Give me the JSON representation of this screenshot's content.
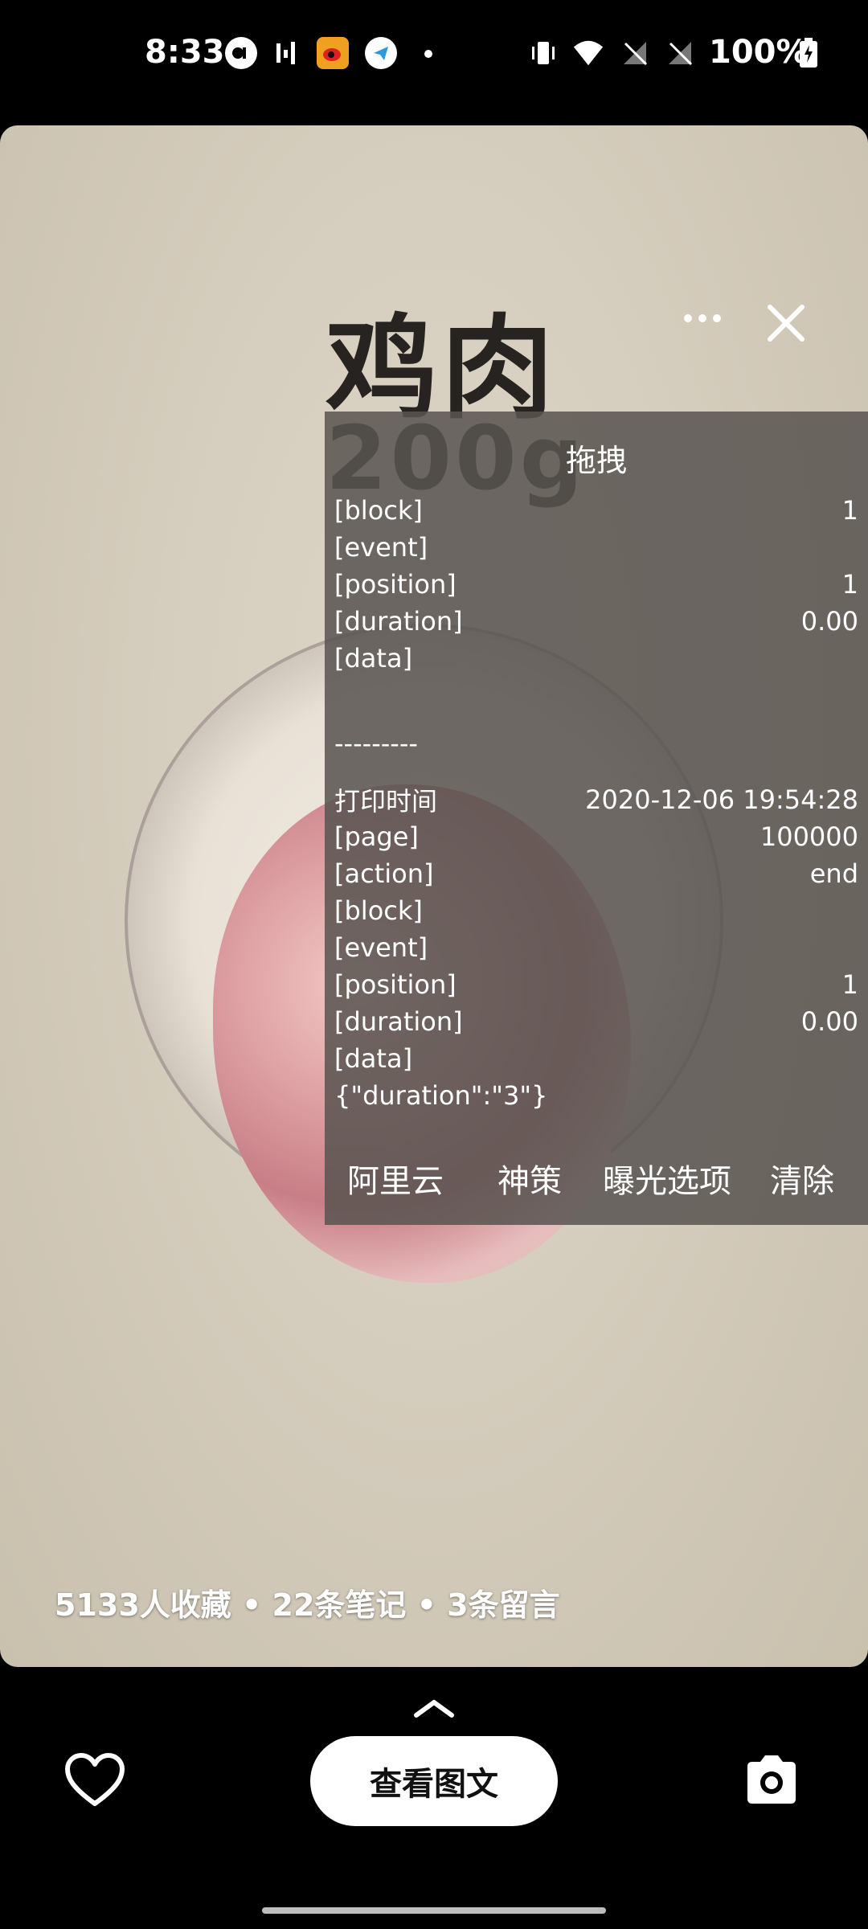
{
  "status_bar": {
    "time": "8:33",
    "battery": "100%"
  },
  "card": {
    "title_line1": "鸡肉",
    "title_line2": "200g",
    "stats": "5133人收藏 • 22条笔记 • 3条留言"
  },
  "debug_overlay": {
    "title": "拖拽",
    "rows": [
      {
        "label": "[block]",
        "value": "1"
      },
      {
        "label": "[event]",
        "value": ""
      },
      {
        "label": "[position]",
        "value": "1"
      },
      {
        "label": "[duration]",
        "value": "0.00"
      },
      {
        "label": "[data]",
        "value": ""
      },
      {
        "label": "",
        "value": ""
      },
      {
        "label": "---------",
        "value": ""
      },
      {
        "label": "打印时间",
        "value": "2020-12-06 19:54:28"
      },
      {
        "label": "[page]",
        "value": "100000"
      },
      {
        "label": "[action]",
        "value": "end"
      },
      {
        "label": "[block]",
        "value": ""
      },
      {
        "label": "[event]",
        "value": ""
      },
      {
        "label": "[position]",
        "value": "1"
      },
      {
        "label": "[duration]",
        "value": "0.00"
      },
      {
        "label": "[data]",
        "value": ""
      },
      {
        "label": "{\"duration\":\"3\"}",
        "value": ""
      }
    ],
    "buttons": [
      "阿里云",
      "神策",
      "曝光选项",
      "清除"
    ]
  },
  "bottom_bar": {
    "view_button": "查看图文"
  },
  "colors": {
    "overlay_bg": "#58544f",
    "card_bg": "#d5cdbd",
    "title_text": "#262320"
  }
}
